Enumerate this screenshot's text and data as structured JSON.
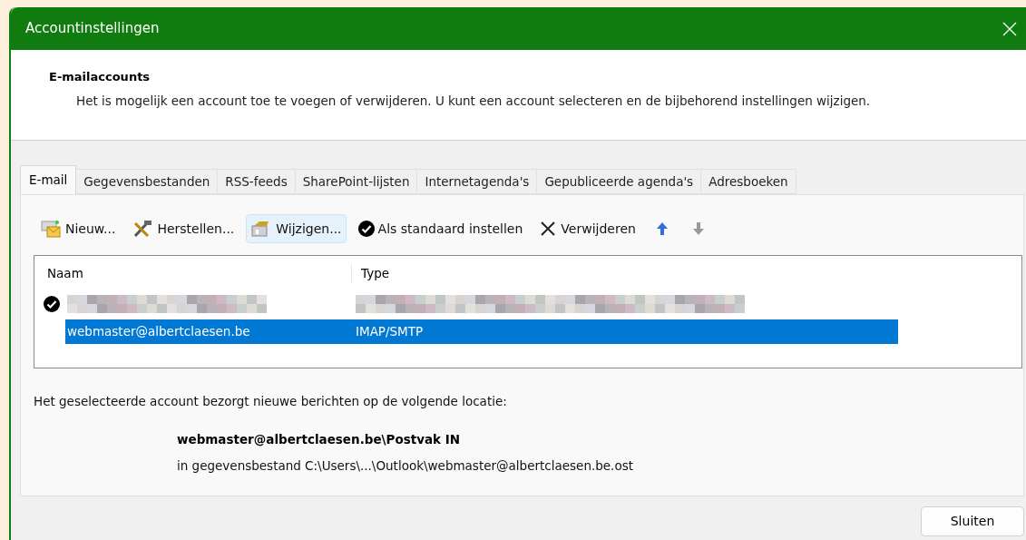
{
  "window": {
    "title": "Accountinstellingen"
  },
  "header": {
    "title": "E-mailaccounts",
    "description": "Het is mogelijk een account toe te voegen of verwijderen. U kunt een account selecteren en de bijbehorend instellingen wijzigen."
  },
  "tabs": [
    {
      "label": "E-mail",
      "selected": true
    },
    {
      "label": "Gegevensbestanden",
      "selected": false
    },
    {
      "label": "RSS-feeds",
      "selected": false
    },
    {
      "label": "SharePoint-lijsten",
      "selected": false
    },
    {
      "label": "Internetagenda's",
      "selected": false
    },
    {
      "label": "Gepubliceerde agenda's",
      "selected": false
    },
    {
      "label": "Adresboeken",
      "selected": false
    }
  ],
  "toolbar": [
    {
      "kind": "new",
      "label": "Nieuw...",
      "hovered": false,
      "disabled": false
    },
    {
      "kind": "repair",
      "label": "Herstellen...",
      "hovered": false,
      "disabled": false
    },
    {
      "kind": "change",
      "label": "Wijzigen...",
      "hovered": true,
      "disabled": false
    },
    {
      "kind": "default",
      "label": "Als standaard instellen",
      "hovered": false,
      "disabled": false
    },
    {
      "kind": "remove",
      "label": "Verwijderen",
      "hovered": false,
      "disabled": false
    },
    {
      "kind": "up",
      "hovered": false,
      "disabled": false
    },
    {
      "kind": "down",
      "hovered": false,
      "disabled": true
    }
  ],
  "accounts": {
    "columns": [
      "Naam",
      "Type"
    ],
    "rows": [
      {
        "kind": "redacted",
        "default": true,
        "selected": false
      },
      {
        "kind": "text",
        "name": "webmaster@albertclaesen.be",
        "type": "IMAP/SMTP",
        "default": false,
        "selected": true
      }
    ]
  },
  "location": {
    "intro": "Het geselecteerde account bezorgt nieuwe berichten op de volgende locatie:",
    "folder": "webmaster@albertclaesen.be\\Postvak IN",
    "file": "in gegevensbestand C:\\Users\\...\\Outlook\\webmaster@albertclaesen.be.ost"
  },
  "buttons": [
    "Sluiten"
  ]
}
